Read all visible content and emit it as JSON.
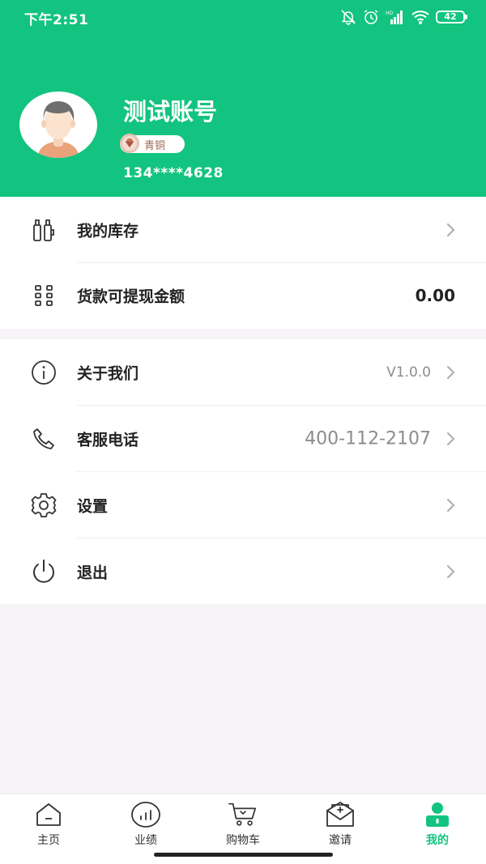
{
  "status_bar": {
    "time": "下午2:51",
    "battery": "42",
    "icons": [
      "bell-muted-icon",
      "alarm-icon",
      "hd-signal-icon",
      "wifi-icon",
      "battery-icon"
    ]
  },
  "profile": {
    "name": "测试账号",
    "level": "青铜",
    "phone": "134****4628",
    "avatar_icon": "user-avatar-icon",
    "level_icon": "bronze-gem-icon"
  },
  "menu_group_1": [
    {
      "icon": "inventory-icon",
      "label": "我的库存",
      "value": "",
      "has_chevron": true
    },
    {
      "icon": "grid-dots-icon",
      "label": "货款可提现金额",
      "value": "0.00",
      "has_chevron": false
    }
  ],
  "menu_group_2": [
    {
      "icon": "info-icon",
      "label": "关于我们",
      "value": "V1.0.0",
      "has_chevron": true
    },
    {
      "icon": "phone-icon",
      "label": "客服电话",
      "value": "400-112-2107",
      "has_chevron": true
    },
    {
      "icon": "gear-icon",
      "label": "设置",
      "value": "",
      "has_chevron": true
    },
    {
      "icon": "power-icon",
      "label": "退出",
      "value": "",
      "has_chevron": true
    }
  ],
  "tabbar": {
    "tabs": [
      {
        "icon": "home-icon",
        "label": "主页",
        "active": false
      },
      {
        "icon": "chart-icon",
        "label": "业绩",
        "active": false
      },
      {
        "icon": "cart-icon",
        "label": "购物车",
        "active": false
      },
      {
        "icon": "invite-mail-icon",
        "label": "邀请",
        "active": false
      },
      {
        "icon": "profile-icon",
        "label": "我的",
        "active": true
      }
    ]
  },
  "colors": {
    "brand": "#12c47f",
    "background": "#f6f4f6",
    "text": "#222222",
    "muted": "#8c8c8c"
  }
}
